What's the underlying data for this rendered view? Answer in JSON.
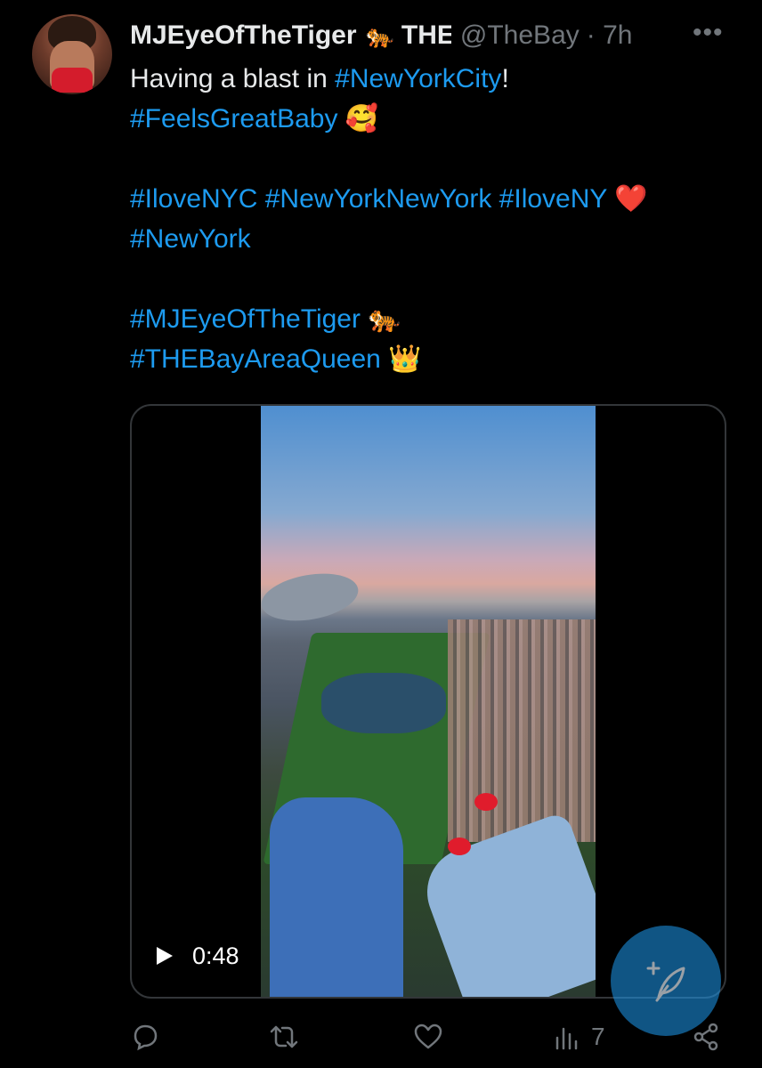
{
  "tweet": {
    "display_name": "MJEyeOfTheTiger",
    "name_emoji": "🐅",
    "name_suffix": "THE",
    "handle": "@TheBay",
    "time": "· 7h",
    "more_icon": "more-icon",
    "body_lines": [
      [
        {
          "t": "Having a blast in ",
          "tag": false
        },
        {
          "t": "#NewYorkCity",
          "tag": true
        },
        {
          "t": "!",
          "tag": false
        }
      ],
      [
        {
          "t": "#FeelsGreatBaby",
          "tag": true
        },
        {
          "t": " 🥰",
          "tag": false
        }
      ],
      [],
      [
        {
          "t": "#IloveNYC",
          "tag": true
        },
        {
          "t": " ",
          "tag": false
        },
        {
          "t": "#NewYorkNewYork",
          "tag": true
        },
        {
          "t": " ",
          "tag": false
        },
        {
          "t": "#IloveNY",
          "tag": true
        },
        {
          "t": " ❤️",
          "tag": false
        }
      ],
      [
        {
          "t": "#NewYork",
          "tag": true
        }
      ],
      [],
      [
        {
          "t": "#MJEyeOfTheTiger",
          "tag": true
        },
        {
          "t": " 🐅",
          "tag": false
        }
      ],
      [
        {
          "t": "#THEBayAreaQueen",
          "tag": true
        },
        {
          "t": " 👑",
          "tag": false
        }
      ]
    ]
  },
  "video": {
    "duration": "0:48",
    "play_icon": "play-icon"
  },
  "actions": {
    "reply_icon": "reply-icon",
    "retweet_icon": "retweet-icon",
    "like_icon": "like-icon",
    "views_icon": "views-icon",
    "views_count": "7",
    "share_icon": "share-icon"
  },
  "fab": {
    "icon": "compose-icon"
  },
  "colors": {
    "accent": "#1d9bf0",
    "text": "#e7e9ea",
    "muted": "#71767b",
    "background": "#000000"
  }
}
